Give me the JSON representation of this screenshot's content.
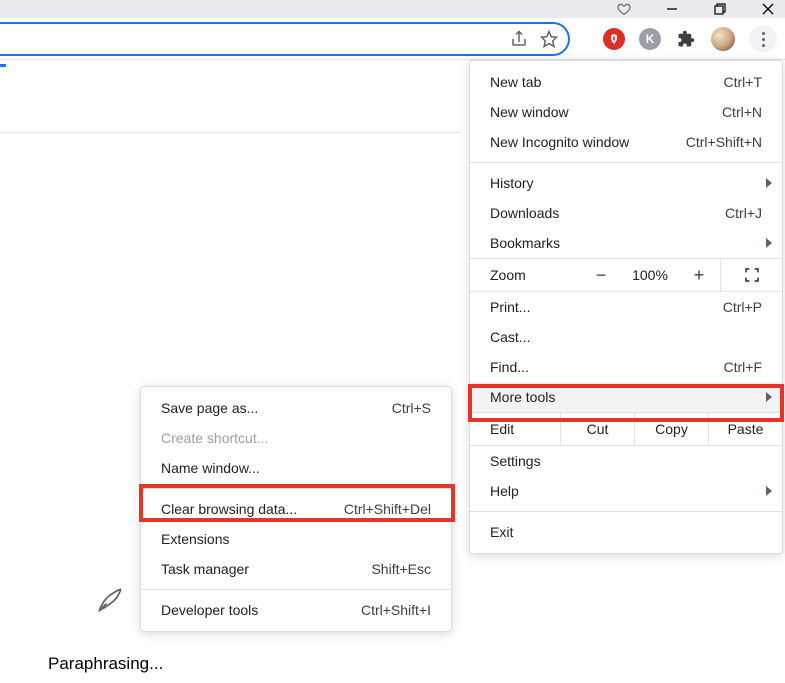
{
  "window_controls": {
    "heart": "♡",
    "minimize": "−",
    "restore": "❐",
    "close": "✕"
  },
  "omnibox": {
    "value": "",
    "placeholder": ""
  },
  "toolbar": {
    "ext_red_letter": "✋",
    "ext_grey_letter": "K"
  },
  "main_menu": {
    "new_tab": "New tab",
    "new_tab_sc": "Ctrl+T",
    "new_window": "New window",
    "new_window_sc": "Ctrl+N",
    "new_incognito": "New Incognito window",
    "new_incognito_sc": "Ctrl+Shift+N",
    "history": "History",
    "downloads": "Downloads",
    "downloads_sc": "Ctrl+J",
    "bookmarks": "Bookmarks",
    "zoom": "Zoom",
    "zoom_minus": "−",
    "zoom_value": "100%",
    "zoom_plus": "+",
    "print": "Print...",
    "print_sc": "Ctrl+P",
    "cast": "Cast...",
    "find": "Find...",
    "find_sc": "Ctrl+F",
    "more_tools": "More tools",
    "edit": "Edit",
    "cut": "Cut",
    "copy": "Copy",
    "paste": "Paste",
    "settings": "Settings",
    "help": "Help",
    "exit": "Exit"
  },
  "sub_menu": {
    "save_page": "Save page as...",
    "save_page_sc": "Ctrl+S",
    "create_shortcut": "Create shortcut...",
    "name_window": "Name window...",
    "clear_browsing": "Clear browsing data...",
    "clear_browsing_sc": "Ctrl+Shift+Del",
    "extensions": "Extensions",
    "task_manager": "Task manager",
    "task_manager_sc": "Shift+Esc",
    "developer_tools": "Developer tools",
    "developer_tools_sc": "Ctrl+Shift+I"
  },
  "status": "Paraphrasing..."
}
